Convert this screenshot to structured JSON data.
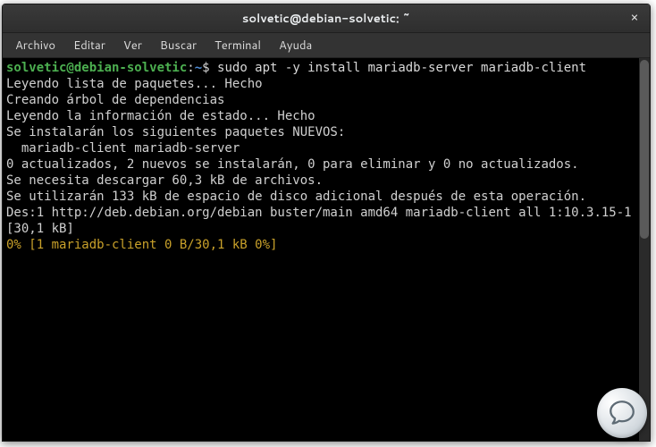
{
  "titlebar": {
    "title": "solvetic@debian-solvetic: ~",
    "close": "×"
  },
  "menu": {
    "file": "Archivo",
    "edit": "Editar",
    "view": "Ver",
    "search": "Buscar",
    "terminal": "Terminal",
    "help": "Ayuda"
  },
  "prompt": {
    "userhost": "solvetic@debian-solvetic",
    "sep": ":",
    "path": "~",
    "symbol": "$ ",
    "command": "sudo apt -y install mariadb-server mariadb-client"
  },
  "output": {
    "l1": "Leyendo lista de paquetes... Hecho",
    "l2": "Creando árbol de dependencias",
    "l3": "Leyendo la información de estado... Hecho",
    "l4": "Se instalarán los siguientes paquetes NUEVOS:",
    "l5": "  mariadb-client mariadb-server",
    "l6": "0 actualizados, 2 nuevos se instalarán, 0 para eliminar y 0 no actualizados.",
    "l7": "Se necesita descargar 60,3 kB de archivos.",
    "l8": "Se utilizarán 133 kB de espacio de disco adicional después de esta operación.",
    "l9": "Des:1 http://deb.debian.org/debian buster/main amd64 mariadb-client all 1:10.3.15-1 [30,1 kB]",
    "progress": "0% [1 mariadb-client 0 B/30,1 kB 0%]"
  }
}
